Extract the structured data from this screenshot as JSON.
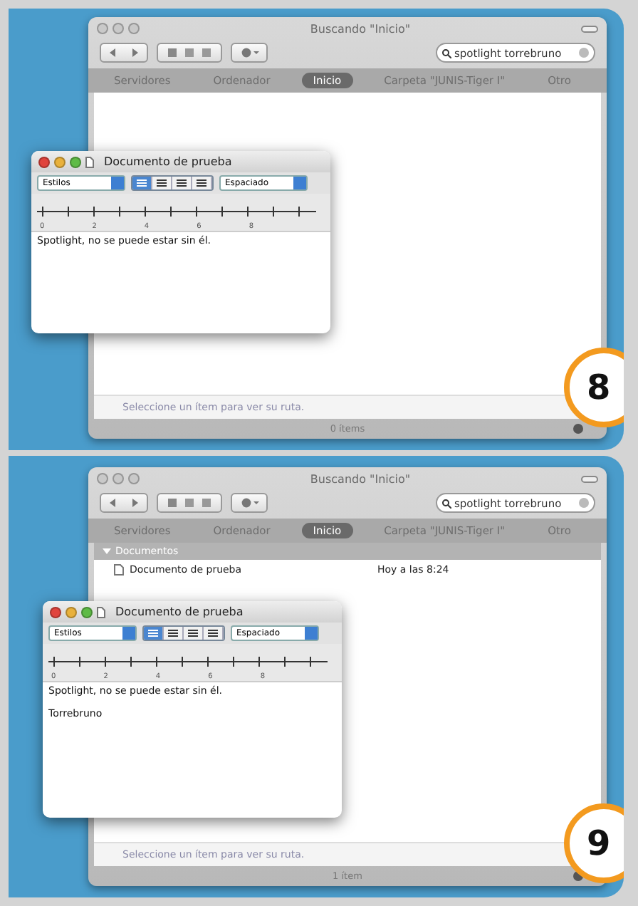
{
  "steps": [
    {
      "number": "8",
      "finder": {
        "title": "Buscando \"Inicio\"",
        "search": "spotlight torrebruno",
        "places": [
          {
            "label": "Servidores",
            "selected": false
          },
          {
            "label": "Ordenador",
            "selected": false
          },
          {
            "label": "Inicio",
            "selected": true
          },
          {
            "label": "Carpeta \"JUNIS-Tiger I\"",
            "selected": false
          },
          {
            "label": "Otro",
            "selected": false
          }
        ],
        "path_hint": "Seleccione un ítem para ver su ruta.",
        "count": "0 ítems"
      },
      "textedit": {
        "title": "Documento de prueba",
        "styles": "Estilos",
        "spacing": "Espaciado",
        "align": [
          {
            "selected": true
          },
          {
            "selected": false
          },
          {
            "selected": false
          },
          {
            "selected": false
          }
        ],
        "ruler": [
          "0",
          "2",
          "4",
          "6",
          "8"
        ],
        "lines": [
          "Spotlight, no se puede estar sin él."
        ]
      }
    },
    {
      "number": "9",
      "finder": {
        "title": "Buscando \"Inicio\"",
        "search": "spotlight torrebruno",
        "places": [
          {
            "label": "Servidores",
            "selected": false
          },
          {
            "label": "Ordenador",
            "selected": false
          },
          {
            "label": "Inicio",
            "selected": true
          },
          {
            "label": "Carpeta \"JUNIS-Tiger I\"",
            "selected": false
          },
          {
            "label": "Otro",
            "selected": false
          }
        ],
        "groups": [
          {
            "title": "Documentos",
            "expanded": true,
            "items": [
              {
                "name": "Documento de prueba",
                "date": "Hoy a las 8:24"
              }
            ]
          }
        ],
        "path_hint": "Seleccione un ítem para ver su ruta.",
        "count": "1 ítem"
      },
      "textedit": {
        "title": "Documento de prueba",
        "styles": "Estilos",
        "spacing": "Espaciado",
        "align": [
          {
            "selected": true
          },
          {
            "selected": false
          },
          {
            "selected": false
          },
          {
            "selected": false
          }
        ],
        "ruler": [
          "0",
          "2",
          "4",
          "6",
          "8"
        ],
        "lines": [
          "Spotlight, no se puede estar sin él.",
          "Torrebruno"
        ]
      }
    }
  ]
}
